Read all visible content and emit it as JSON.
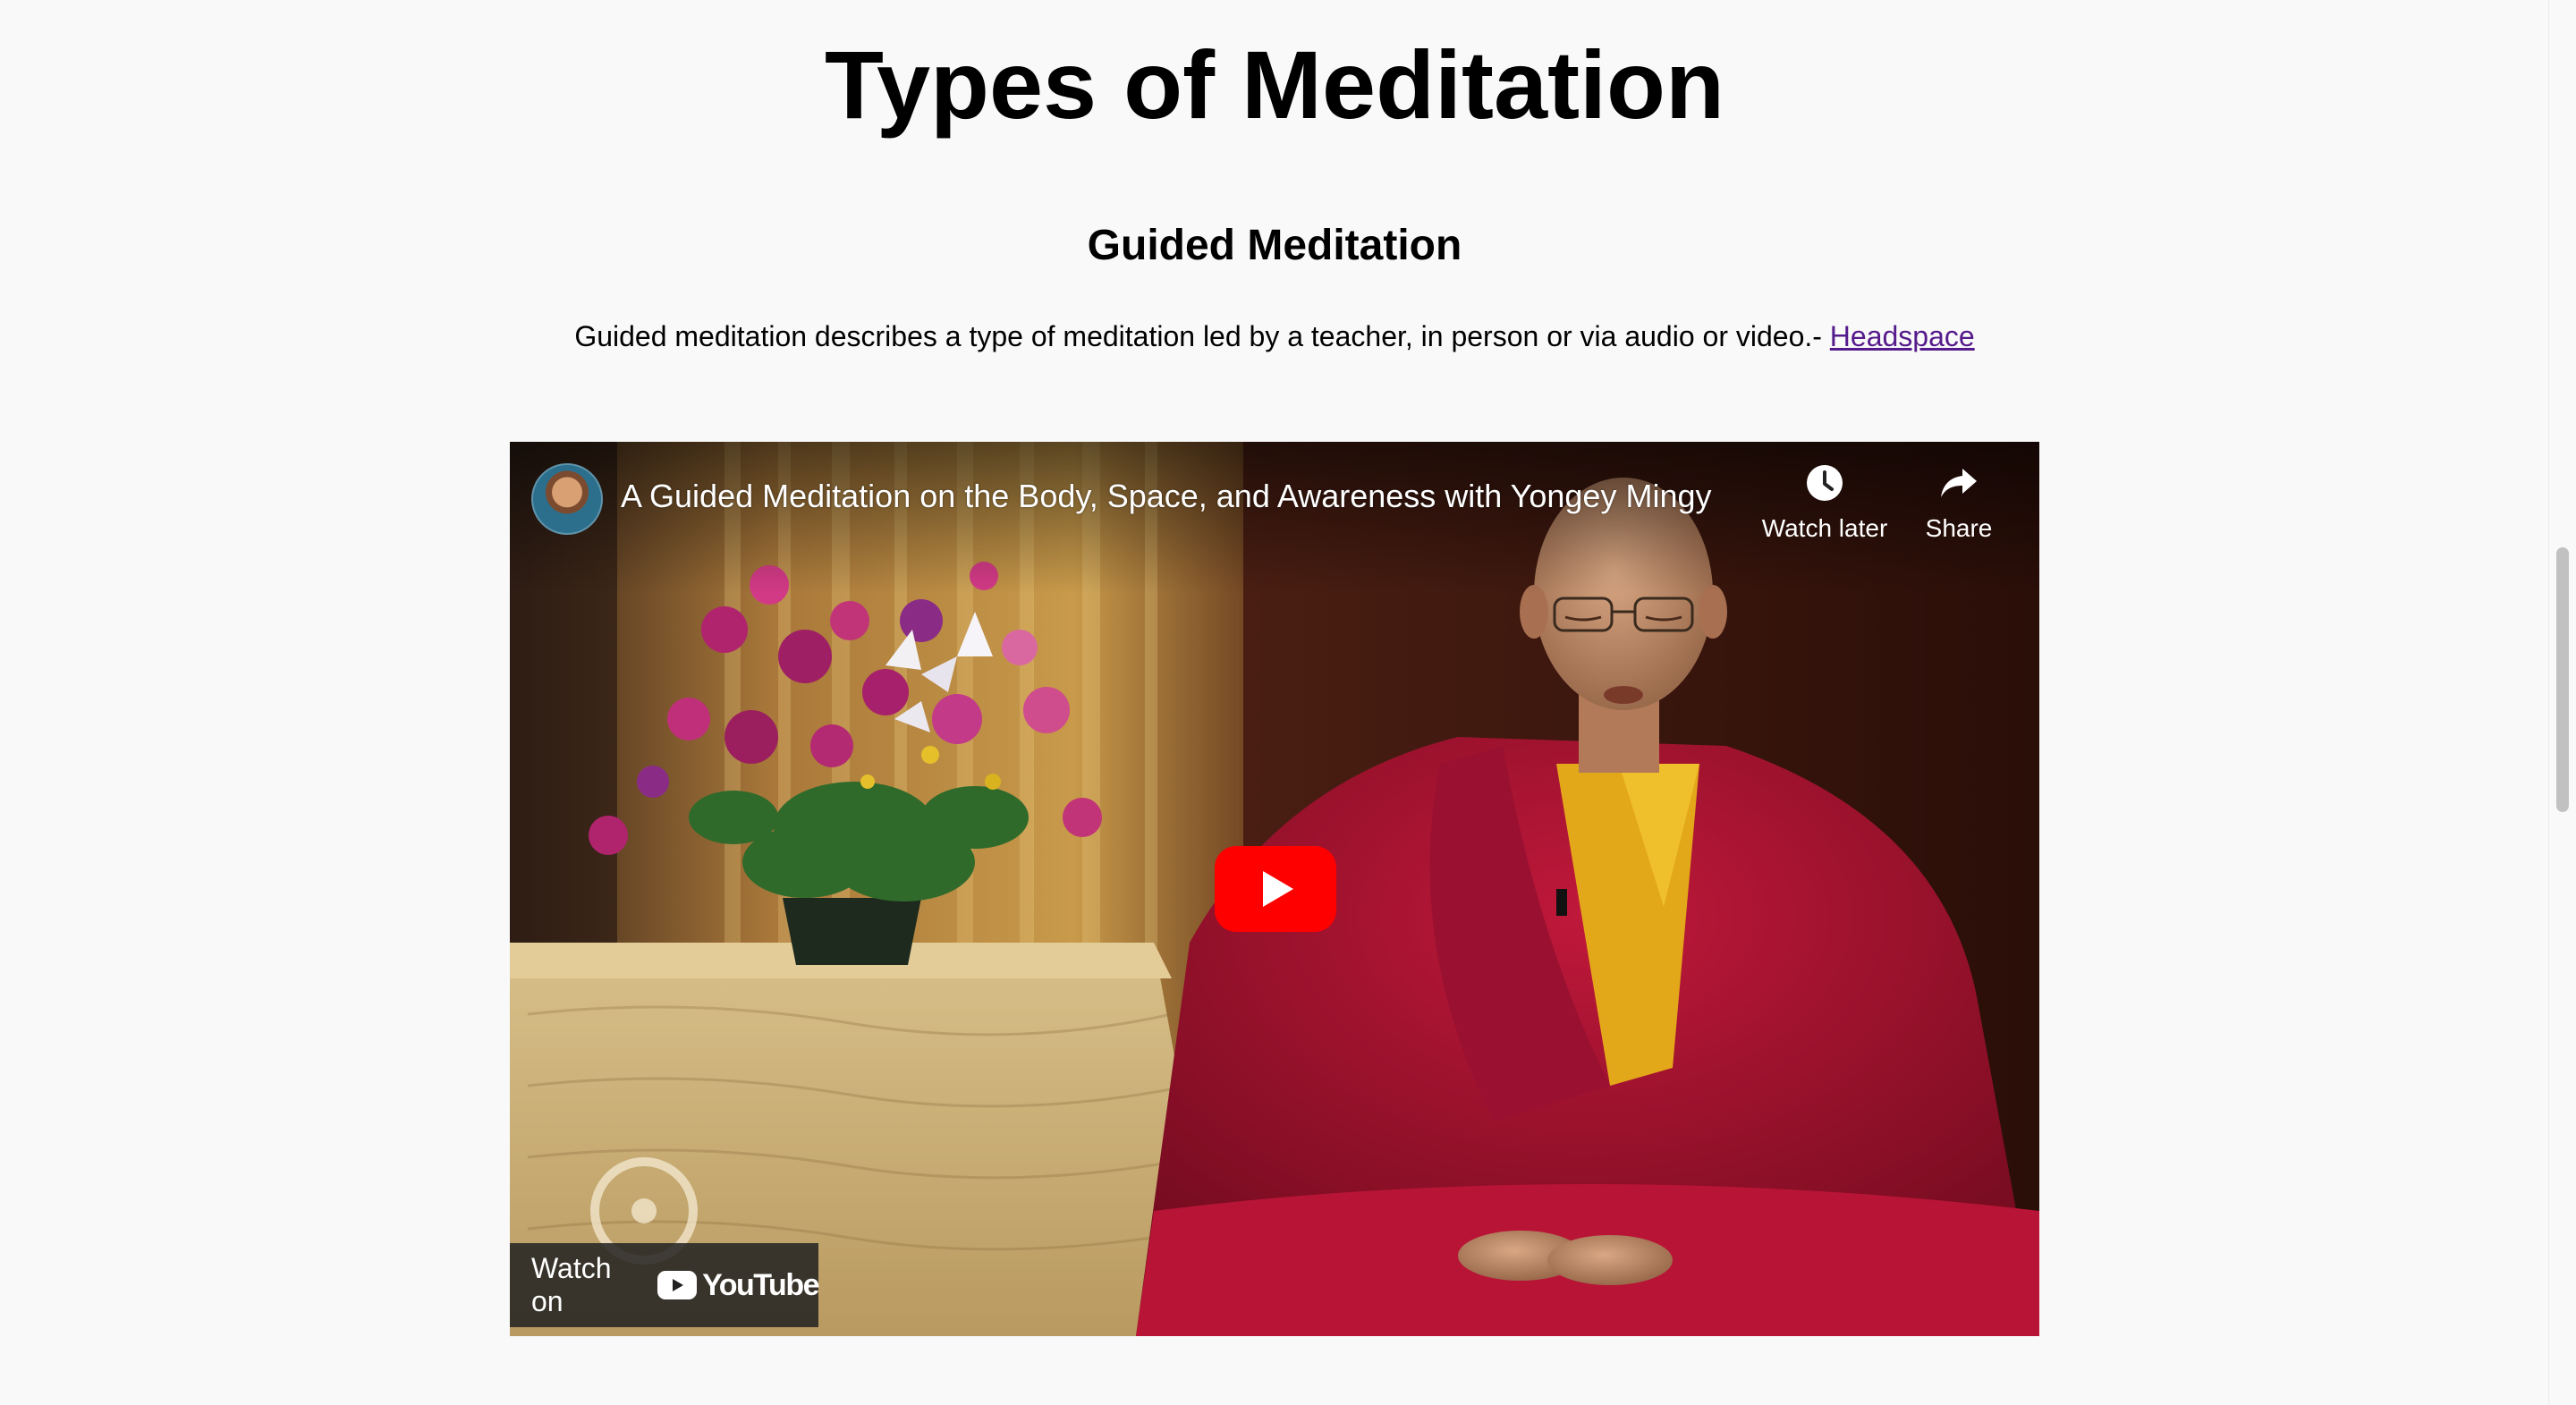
{
  "page": {
    "title": "Types of Meditation"
  },
  "section": {
    "title": "Guided Meditation",
    "description": "Guided meditation describes a type of meditation led by a teacher, in person or via audio or video.- ",
    "link_label": "Headspace"
  },
  "video": {
    "title": "A Guided Meditation on the Body, Space, and Awareness with Yongey Mingy…",
    "watch_later_label": "Watch later",
    "share_label": "Share",
    "watch_on_label": "Watch on",
    "youtube_label": "YouTube",
    "play_button_color": "#ff0000",
    "icons": {
      "avatar": "channel-avatar",
      "watch_later": "clock-icon",
      "share": "share-arrow-icon",
      "play": "play-icon",
      "logo": "youtube-logo-icon"
    }
  },
  "scrollbar": {
    "scroll_position": 0.38
  }
}
